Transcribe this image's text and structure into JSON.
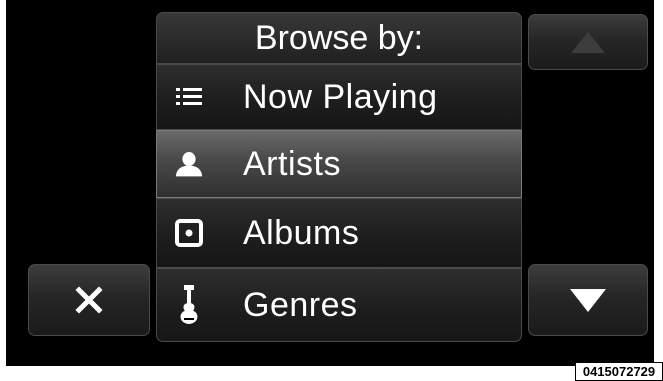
{
  "header": {
    "title": "Browse by:"
  },
  "menu": {
    "items": [
      {
        "label": "Now Playing",
        "icon": "list-icon",
        "selected": false
      },
      {
        "label": "Artists",
        "icon": "person-icon",
        "selected": true
      },
      {
        "label": "Albums",
        "icon": "album-icon",
        "selected": false
      },
      {
        "label": "Genres",
        "icon": "guitar-icon",
        "selected": false
      }
    ]
  },
  "controls": {
    "scroll_up": {
      "icon": "triangle-up-icon"
    },
    "scroll_down": {
      "icon": "triangle-down-icon"
    },
    "close": {
      "icon": "close-icon"
    }
  },
  "watermark": {
    "code": "0415072729"
  },
  "colors": {
    "background": "#000000",
    "text": "#ffffff",
    "selected_row": "#555555"
  }
}
